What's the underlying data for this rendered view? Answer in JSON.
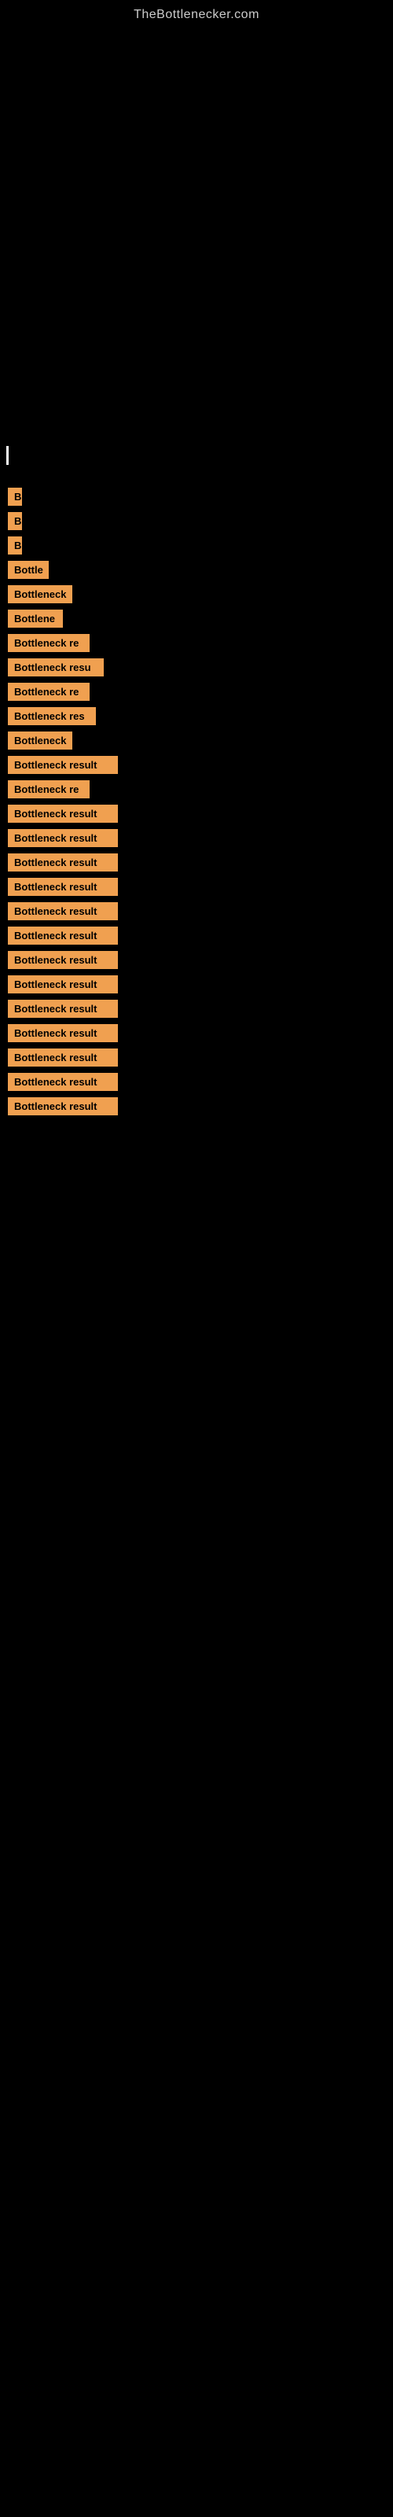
{
  "site": {
    "title": "TheBottlenecker.com"
  },
  "results": [
    {
      "id": 1,
      "label": "B",
      "width": 18
    },
    {
      "id": 2,
      "label": "B",
      "width": 18
    },
    {
      "id": 3,
      "label": "B",
      "width": 18
    },
    {
      "id": 4,
      "label": "Bottle",
      "width": 52
    },
    {
      "id": 5,
      "label": "Bottleneck",
      "width": 82
    },
    {
      "id": 6,
      "label": "Bottlene",
      "width": 70
    },
    {
      "id": 7,
      "label": "Bottleneck re",
      "width": 104
    },
    {
      "id": 8,
      "label": "Bottleneck resu",
      "width": 122
    },
    {
      "id": 9,
      "label": "Bottleneck re",
      "width": 104
    },
    {
      "id": 10,
      "label": "Bottleneck res",
      "width": 112
    },
    {
      "id": 11,
      "label": "Bottleneck",
      "width": 82
    },
    {
      "id": 12,
      "label": "Bottleneck result",
      "width": 140
    },
    {
      "id": 13,
      "label": "Bottleneck re",
      "width": 104
    },
    {
      "id": 14,
      "label": "Bottleneck result",
      "width": 140
    },
    {
      "id": 15,
      "label": "Bottleneck result",
      "width": 140
    },
    {
      "id": 16,
      "label": "Bottleneck result",
      "width": 140
    },
    {
      "id": 17,
      "label": "Bottleneck result",
      "width": 140
    },
    {
      "id": 18,
      "label": "Bottleneck result",
      "width": 140
    },
    {
      "id": 19,
      "label": "Bottleneck result",
      "width": 140
    },
    {
      "id": 20,
      "label": "Bottleneck result",
      "width": 140
    },
    {
      "id": 21,
      "label": "Bottleneck result",
      "width": 140
    },
    {
      "id": 22,
      "label": "Bottleneck result",
      "width": 140
    },
    {
      "id": 23,
      "label": "Bottleneck result",
      "width": 140
    },
    {
      "id": 24,
      "label": "Bottleneck result",
      "width": 140
    },
    {
      "id": 25,
      "label": "Bottleneck result",
      "width": 140
    },
    {
      "id": 26,
      "label": "Bottleneck result",
      "width": 140
    }
  ]
}
